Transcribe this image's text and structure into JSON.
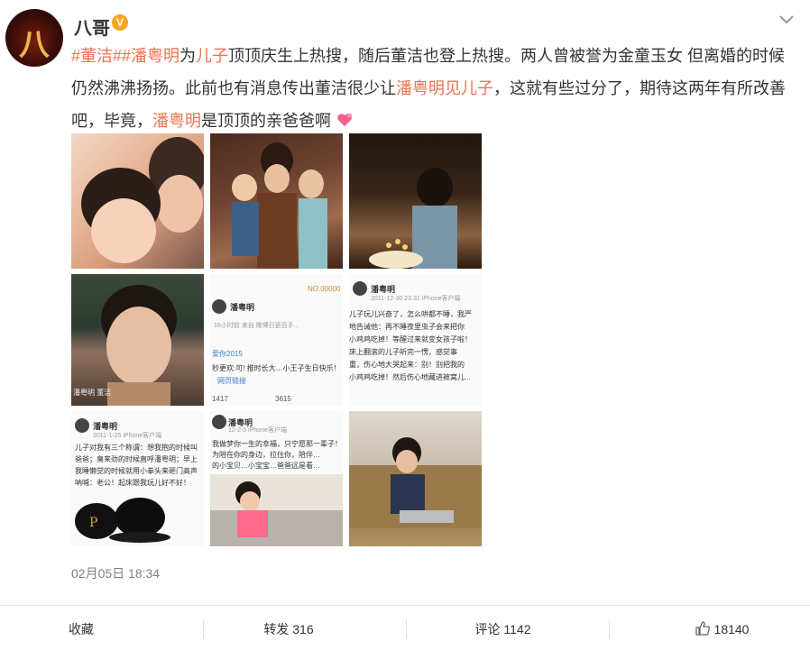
{
  "user": {
    "name": "八哥",
    "avatar_text": "八"
  },
  "post": {
    "segments": [
      {
        "text": "#董洁#",
        "link": true
      },
      {
        "text": "#潘粤明",
        "link": true
      },
      {
        "text": "为",
        "link": false
      },
      {
        "text": "儿子",
        "link": true
      },
      {
        "text": "顶顶庆生上热搜，随后董洁也登上热搜。两人曾被誉为金童玉女 但离婚的时候仍然沸沸扬扬。此前也有消息传出董洁很少让",
        "link": false
      },
      {
        "text": "潘粤明见儿子",
        "link": true
      },
      {
        "text": "，这就有些过分了，期待这两年有所改善吧，毕竟，",
        "link": false
      },
      {
        "text": "潘粤明",
        "link": true
      },
      {
        "text": "是顶顶的亲爸爸啊",
        "link": false
      }
    ],
    "time": "02月05日 18:34"
  },
  "photos": {
    "p5": {
      "name": "潘粤明",
      "meta": "16小时前  来自 微博日更百手...",
      "line1": "爱你2015",
      "line2": "秒更欢:可!  推时长大…小王子生日快乐！",
      "line3": "网页链接",
      "repost": "1417",
      "comments": "3615",
      "topright": "NO.00000"
    },
    "p6": {
      "name": "潘粤明",
      "meta": "2011-12-30 23:31  iPhone客户端",
      "lines": [
        "儿子玩儿兴奋了，怎么哄都不睡，我严",
        "地告诫他：再不睡夜里虫子会来把你",
        "小鸡鸡吃掉！等醒过来就变女孩子啦！",
        "床上翻滚的儿子听完一愣，感觉事",
        "重，伤心地大哭起来：别！别把我的",
        "小鸡鸡吃掉！然后伤心地藏进被窝儿..."
      ]
    },
    "p4": {
      "caption": "潘粤明 董洁"
    },
    "p7": {
      "name": "潘粤明",
      "meta": "2011-1-25  iPhone客户端",
      "lines": [
        "儿子对我有三个称谓：想我抱的时候叫",
        "爸爸；臭来劲的时候直呼潘粤明；早上",
        "我睡懒觉的时候就用小拳头来砸门高声",
        "呐喊：老公！起床跟我玩儿好不好！"
      ]
    },
    "p8": {
      "name": "潘粤明",
      "meta": "12-2-5  iPhone客户端",
      "lines": [
        "我做梦你一生的幸福，只宁愿那一辈子！",
        "为陪在你的身边，拉住你，陪伴…",
        "的小宝贝…小宝宝…爸爸远是看…"
      ]
    }
  },
  "actions": {
    "favorite": "收藏",
    "repost": "转发 316",
    "comment": "评论 1142",
    "like": "18140"
  },
  "colors": {
    "link": "#eb7350",
    "vbadge": "#f7a51c"
  }
}
